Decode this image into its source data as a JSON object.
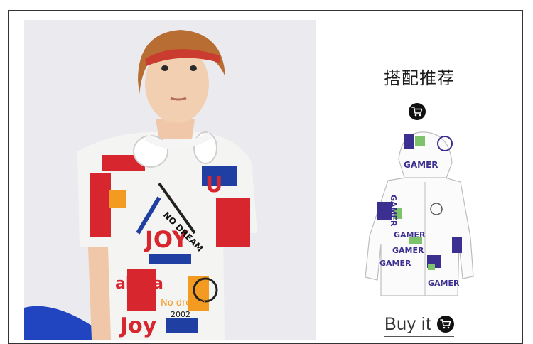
{
  "section": {
    "title": "搭配推荐"
  },
  "model_photo": {
    "shirt_prints": [
      "JOY",
      "NO DREAM",
      "No dream",
      "abala",
      "2002",
      "U",
      "Joy"
    ]
  },
  "product": {
    "jacket_prints": [
      "GAMER",
      "GAMER",
      "GAMER",
      "GAMER",
      "GAMER",
      "GAMER"
    ]
  },
  "buy_link": {
    "label": "Buy it"
  },
  "icons": {
    "cart": "shopping-cart-icon"
  },
  "colors": {
    "text": "#1b1b1b",
    "badge": "#111111",
    "frame": "#333333",
    "print_red": "#d7262d",
    "print_blue": "#1f3fa3",
    "print_orange": "#f39a21",
    "jacket_purple": "#3b2f8f",
    "jacket_green": "#7cc36a"
  }
}
